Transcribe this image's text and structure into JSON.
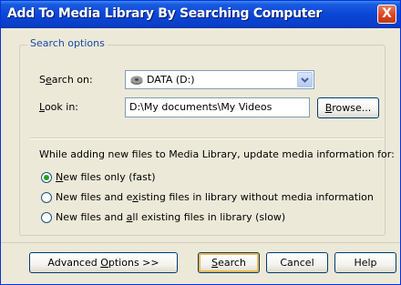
{
  "window": {
    "title": "Add To Media Library By Searching Computer",
    "close_glyph": "X"
  },
  "search_options": {
    "legend": "Search options",
    "search_on_label_pre": "S",
    "search_on_label_u": "e",
    "search_on_label_post": "arch on:",
    "search_on_value": "DATA (D:)",
    "search_on_icon": "drive-icon",
    "look_in_label_u": "L",
    "look_in_label_post": "ook in:",
    "look_in_value": "D:\\My documents\\My Videos",
    "browse_u": "B",
    "browse_rest": "rowse..."
  },
  "update_info": {
    "prompt": "While adding new files to Media Library, update media information for:",
    "options": [
      {
        "pre": "",
        "u": "N",
        "post": "ew files only (fast)",
        "selected": true
      },
      {
        "pre": "New files and e",
        "u": "x",
        "post": "isting files in library without media information",
        "selected": false
      },
      {
        "pre": "New files and ",
        "u": "a",
        "post": "ll existing files in library (slow)",
        "selected": false
      }
    ]
  },
  "buttons": {
    "advanced_pre": "Advanced ",
    "advanced_u": "O",
    "advanced_post": "ptions >>",
    "search_u": "S",
    "search_post": "earch",
    "cancel": "Cancel",
    "help": "Help"
  }
}
